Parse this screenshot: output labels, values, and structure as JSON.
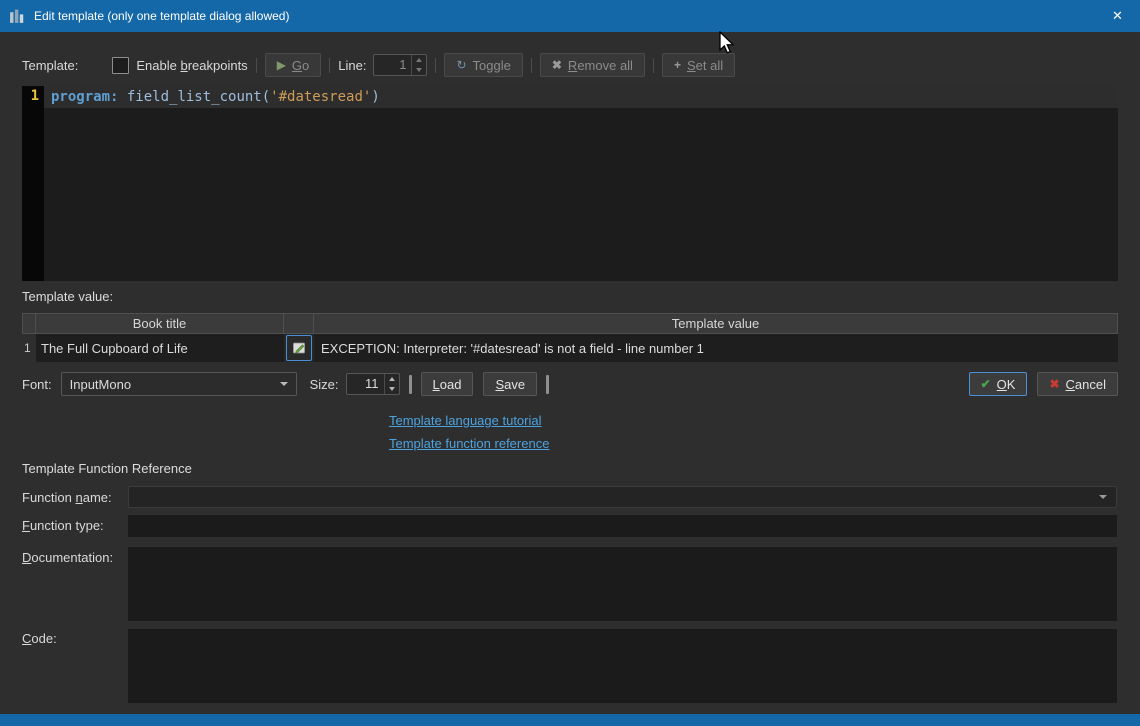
{
  "colors": {
    "titlebar_blue": "#1568a8",
    "dialog_bg": "#2e2e2e",
    "editor_bg": "#1c1c1c",
    "current_line_bg": "#2d2d2d",
    "accent_border": "#4a90d6",
    "link_blue": "#4da3e0",
    "code_keyword": "#5f9fd3",
    "code_function": "#9dbedd",
    "code_string": "#cf9c58",
    "line_number_yellow": "#e4c63a",
    "ok_check_green": "#49a64d",
    "cancel_red": "#c93a33"
  },
  "icons": {
    "close": "✕",
    "go": "▶",
    "toggle": "↻",
    "remove_all": "✖",
    "set_all": "+",
    "ok": "✔",
    "cancel": "✖"
  },
  "titlebar": {
    "title": "Edit template (only one template dialog allowed)"
  },
  "toolbar": {
    "template_label": "Template:",
    "enable_breakpoints": "Enable &breakpoints",
    "go": "&Go",
    "line_label": "Line:",
    "line_value": "1",
    "toggle": "Toggle",
    "remove_all": "&Remove all",
    "set_all": "&Set all"
  },
  "editor": {
    "line_number": "1",
    "code": {
      "keyword": "program:",
      "function": " field_list_count(",
      "string": "'#datesread'",
      "close_paren": ")"
    }
  },
  "template_value": {
    "label": "Template value:",
    "columns": {
      "book_title": "Book title",
      "template_value": "Template value"
    },
    "row": {
      "number": "1",
      "book_title": "The Full Cupboard of Life",
      "value": "EXCEPTION: Interpreter: '#datesread' is not a field - line number 1"
    }
  },
  "font_row": {
    "font_label": "Font:",
    "font_value": "InputMono",
    "size_label": "Size:",
    "size_value": "11",
    "load": "&Load",
    "save": "&Save",
    "ok": "&OK",
    "cancel": "&Cancel"
  },
  "links": {
    "tutorial": "Template language tutorial",
    "function_reference": "Template function reference"
  },
  "function_reference": {
    "title": "Template Function Reference",
    "function_name_label": "Function &name:",
    "function_type_label": "&Function type:",
    "documentation_label": "&Documentation:",
    "code_label": "&Code:"
  }
}
